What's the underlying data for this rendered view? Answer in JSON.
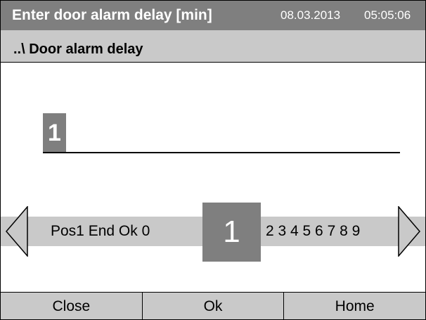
{
  "header": {
    "title": "Enter door alarm delay [min]",
    "date": "08.03.2013",
    "time": "05:05:06"
  },
  "breadcrumb": "..\\ Door alarm delay",
  "entry": {
    "value": "1"
  },
  "selector": {
    "left_options": "Pos1  End Ok 0",
    "selected": "1",
    "right_options": "2 3 4 5 6 7 8 9"
  },
  "buttons": {
    "close": "Close",
    "ok": "Ok",
    "home": "Home"
  },
  "icons": {
    "scroll_left": "triangle-left-icon",
    "scroll_right": "triangle-right-icon"
  },
  "colors": {
    "header_bg": "#7f7f7f",
    "bar_bg": "#c9c9c9",
    "highlight": "#7f7f7f"
  }
}
